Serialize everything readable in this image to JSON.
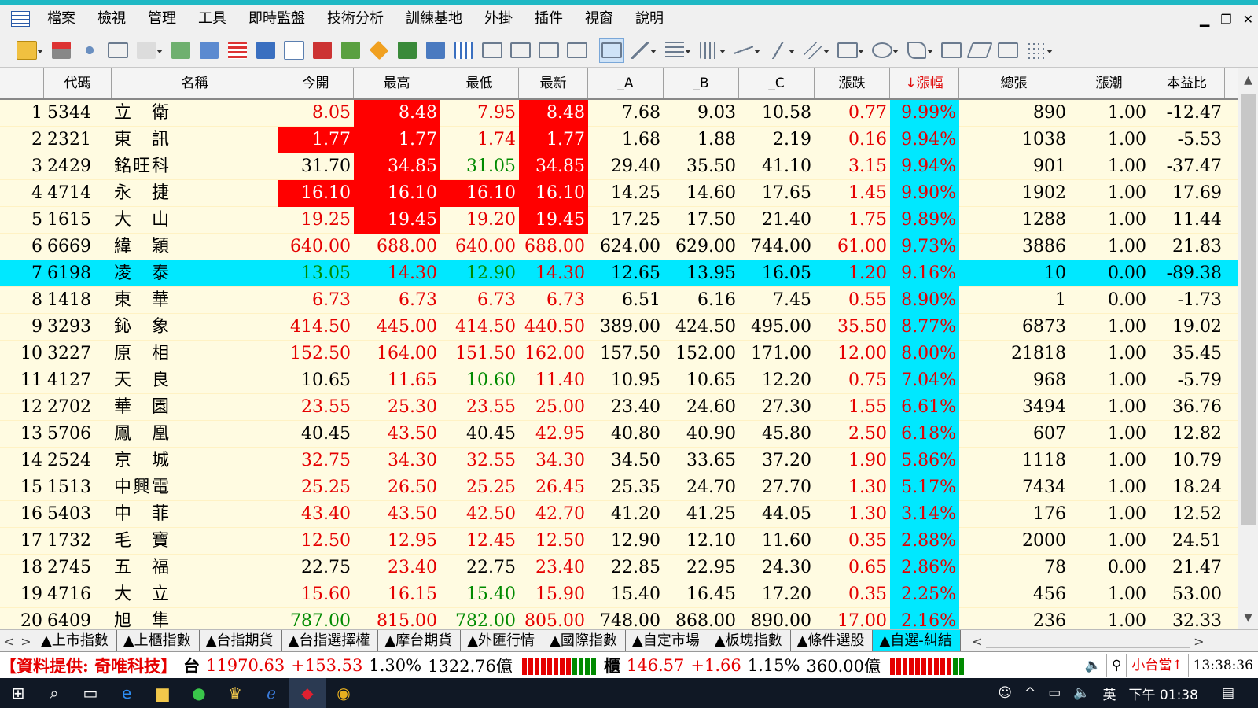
{
  "menu": [
    "檔案",
    "檢視",
    "管理",
    "工具",
    "即時監盤",
    "技術分析",
    "訓練基地",
    "外掛",
    "插件",
    "視窗",
    "說明"
  ],
  "window_controls": [
    "▁",
    "❐",
    "✕"
  ],
  "columns": [
    "代碼",
    "名稱",
    "今開",
    "最高",
    "最低",
    "最新",
    "_A",
    "_B",
    "_C",
    "漲跌",
    "↓漲幅",
    "總張",
    "漲潮",
    "本益比"
  ],
  "rows": [
    {
      "i": "1",
      "code": "5344",
      "name": "立　衛",
      "open": "8.05",
      "high": "8.48",
      "low": "7.95",
      "last": "8.48",
      "a": "7.68",
      "b": "9.03",
      "c": "10.58",
      "chg": "0.77",
      "pct": "9.99%",
      "vol": "890",
      "tide": "1.00",
      "pe": "-12.47"
    },
    {
      "i": "2",
      "code": "2321",
      "name": "東　訊",
      "open": "1.77",
      "high": "1.77",
      "low": "1.74",
      "last": "1.77",
      "a": "1.68",
      "b": "1.88",
      "c": "2.19",
      "chg": "0.16",
      "pct": "9.94%",
      "vol": "1038",
      "tide": "1.00",
      "pe": "-5.53"
    },
    {
      "i": "3",
      "code": "2429",
      "name": "銘旺科",
      "open": "31.70",
      "high": "34.85",
      "low": "31.05",
      "last": "34.85",
      "a": "29.40",
      "b": "35.50",
      "c": "41.10",
      "chg": "3.15",
      "pct": "9.94%",
      "vol": "901",
      "tide": "1.00",
      "pe": "-37.47"
    },
    {
      "i": "4",
      "code": "4714",
      "name": "永　捷",
      "open": "16.10",
      "high": "16.10",
      "low": "16.10",
      "last": "16.10",
      "a": "14.25",
      "b": "14.60",
      "c": "17.65",
      "chg": "1.45",
      "pct": "9.90%",
      "vol": "1902",
      "tide": "1.00",
      "pe": "17.69"
    },
    {
      "i": "5",
      "code": "1615",
      "name": "大　山",
      "open": "19.25",
      "high": "19.45",
      "low": "19.20",
      "last": "19.45",
      "a": "17.25",
      "b": "17.50",
      "c": "21.40",
      "chg": "1.75",
      "pct": "9.89%",
      "vol": "1288",
      "tide": "1.00",
      "pe": "11.44"
    },
    {
      "i": "6",
      "code": "6669",
      "name": "緯　穎",
      "open": "640.00",
      "high": "688.00",
      "low": "640.00",
      "last": "688.00",
      "a": "624.00",
      "b": "629.00",
      "c": "744.00",
      "chg": "61.00",
      "pct": "9.73%",
      "vol": "3886",
      "tide": "1.00",
      "pe": "21.83"
    },
    {
      "i": "7",
      "code": "6198",
      "name": "凌　泰",
      "open": "13.05",
      "high": "14.30",
      "low": "12.90",
      "last": "14.30",
      "a": "12.65",
      "b": "13.95",
      "c": "16.05",
      "chg": "1.20",
      "pct": "9.16%",
      "vol": "10",
      "tide": "0.00",
      "pe": "-89.38"
    },
    {
      "i": "8",
      "code": "1418",
      "name": "東　華",
      "open": "6.73",
      "high": "6.73",
      "low": "6.73",
      "last": "6.73",
      "a": "6.51",
      "b": "6.16",
      "c": "7.45",
      "chg": "0.55",
      "pct": "8.90%",
      "vol": "1",
      "tide": "0.00",
      "pe": "-1.73"
    },
    {
      "i": "9",
      "code": "3293",
      "name": "鈊　象",
      "open": "414.50",
      "high": "445.00",
      "low": "414.50",
      "last": "440.50",
      "a": "389.00",
      "b": "424.50",
      "c": "495.00",
      "chg": "35.50",
      "pct": "8.77%",
      "vol": "6873",
      "tide": "1.00",
      "pe": "19.02"
    },
    {
      "i": "10",
      "code": "3227",
      "name": "原　相",
      "open": "152.50",
      "high": "164.00",
      "low": "151.50",
      "last": "162.00",
      "a": "157.50",
      "b": "152.00",
      "c": "171.00",
      "chg": "12.00",
      "pct": "8.00%",
      "vol": "21818",
      "tide": "1.00",
      "pe": "35.45"
    },
    {
      "i": "11",
      "code": "4127",
      "name": "天　良",
      "open": "10.65",
      "high": "11.65",
      "low": "10.60",
      "last": "11.40",
      "a": "10.95",
      "b": "10.65",
      "c": "12.20",
      "chg": "0.75",
      "pct": "7.04%",
      "vol": "968",
      "tide": "1.00",
      "pe": "-5.79"
    },
    {
      "i": "12",
      "code": "2702",
      "name": "華　園",
      "open": "23.55",
      "high": "25.30",
      "low": "23.55",
      "last": "25.00",
      "a": "23.40",
      "b": "24.60",
      "c": "27.30",
      "chg": "1.55",
      "pct": "6.61%",
      "vol": "3494",
      "tide": "1.00",
      "pe": "36.76"
    },
    {
      "i": "13",
      "code": "5706",
      "name": "鳳　凰",
      "open": "40.45",
      "high": "43.50",
      "low": "40.45",
      "last": "42.95",
      "a": "40.80",
      "b": "40.90",
      "c": "45.80",
      "chg": "2.50",
      "pct": "6.18%",
      "vol": "607",
      "tide": "1.00",
      "pe": "12.82"
    },
    {
      "i": "14",
      "code": "2524",
      "name": "京　城",
      "open": "32.75",
      "high": "34.30",
      "low": "32.55",
      "last": "34.30",
      "a": "34.50",
      "b": "33.65",
      "c": "37.20",
      "chg": "1.90",
      "pct": "5.86%",
      "vol": "1118",
      "tide": "1.00",
      "pe": "10.79"
    },
    {
      "i": "15",
      "code": "1513",
      "name": "中興電",
      "open": "25.25",
      "high": "26.50",
      "low": "25.25",
      "last": "26.45",
      "a": "25.35",
      "b": "24.70",
      "c": "27.70",
      "chg": "1.30",
      "pct": "5.17%",
      "vol": "7434",
      "tide": "1.00",
      "pe": "18.24"
    },
    {
      "i": "16",
      "code": "5403",
      "name": "中　菲",
      "open": "43.40",
      "high": "43.50",
      "low": "42.50",
      "last": "42.70",
      "a": "41.20",
      "b": "41.25",
      "c": "44.05",
      "chg": "1.30",
      "pct": "3.14%",
      "vol": "176",
      "tide": "1.00",
      "pe": "12.52"
    },
    {
      "i": "17",
      "code": "1732",
      "name": "毛　寶",
      "open": "12.50",
      "high": "12.95",
      "low": "12.45",
      "last": "12.50",
      "a": "12.90",
      "b": "12.10",
      "c": "11.60",
      "chg": "0.35",
      "pct": "2.88%",
      "vol": "2000",
      "tide": "1.00",
      "pe": "24.51"
    },
    {
      "i": "18",
      "code": "2745",
      "name": "五　福",
      "open": "22.75",
      "high": "23.40",
      "low": "22.75",
      "last": "23.40",
      "a": "22.85",
      "b": "22.95",
      "c": "24.30",
      "chg": "0.65",
      "pct": "2.86%",
      "vol": "78",
      "tide": "0.00",
      "pe": "21.47"
    },
    {
      "i": "19",
      "code": "4716",
      "name": "大　立",
      "open": "15.60",
      "high": "16.15",
      "low": "15.40",
      "last": "15.90",
      "a": "15.40",
      "b": "16.45",
      "c": "17.20",
      "chg": "0.35",
      "pct": "2.25%",
      "vol": "456",
      "tide": "1.00",
      "pe": "53.00"
    },
    {
      "i": "20",
      "code": "6409",
      "name": "旭　隼",
      "open": "787.00",
      "high": "815.00",
      "low": "782.00",
      "last": "805.00",
      "a": "748.00",
      "b": "868.00",
      "c": "890.00",
      "chg": "17.00",
      "pct": "2.16%",
      "vol": "236",
      "tide": "1.00",
      "pe": "32.33"
    }
  ],
  "tabs": [
    "▲上市指數",
    "▲上櫃指數",
    "▲台指期貨",
    "▲台指選擇權",
    "▲摩台期貨",
    "▲外匯行情",
    "▲國際指數",
    "▲自定市場",
    "▲板塊指數",
    "▲條件選股",
    "▲自選-糾結"
  ],
  "status": {
    "provider": "【資料提供: 奇唯科技】",
    "twse_label": "台",
    "twse_index": "11970.63",
    "twse_change": "+153.53",
    "twse_pct": "1.30%",
    "twse_amount": "1322.76億",
    "otc_label": "櫃",
    "otc_index": "146.57",
    "otc_change": "+1.66",
    "otc_pct": "1.15%",
    "otc_amount": "360.00億",
    "alert": "小台當↑",
    "clock": "13:38:36"
  },
  "taskbar": {
    "ime": "英",
    "time": "下午 01:38"
  },
  "colors": {
    "up_red": "#e50000",
    "down_green": "#008a00",
    "highlight_cyan": "#00e8ff",
    "row_bg": "#fffbe1"
  }
}
